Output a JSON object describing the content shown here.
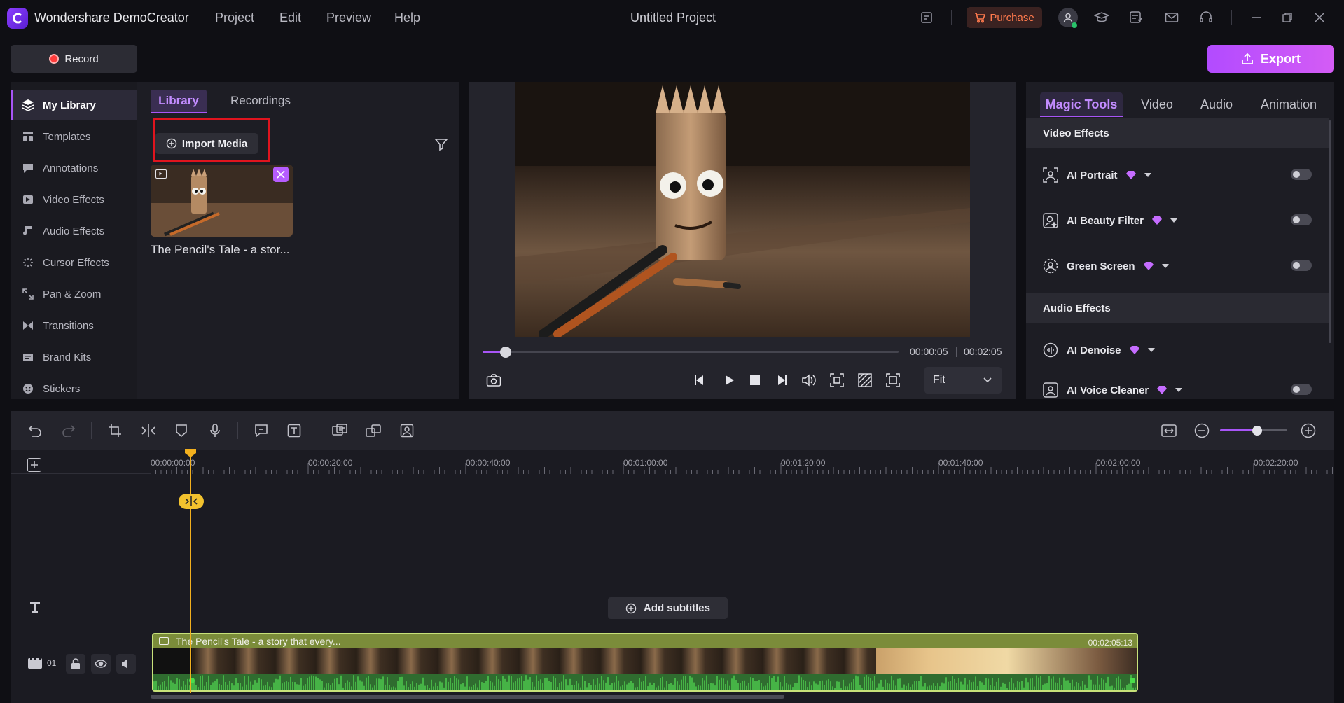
{
  "app": {
    "title": "Wondershare DemoCreator",
    "project_title": "Untitled Project",
    "menu": [
      "Project",
      "Edit",
      "Preview",
      "Help"
    ],
    "purchase_label": "Purchase"
  },
  "actions": {
    "record_label": "Record",
    "export_label": "Export"
  },
  "sidebar": {
    "items": [
      {
        "label": "My Library",
        "icon": "layers-icon",
        "active": true
      },
      {
        "label": "Templates",
        "icon": "templates-icon"
      },
      {
        "label": "Annotations",
        "icon": "annotation-icon"
      },
      {
        "label": "Video Effects",
        "icon": "video-effects-icon"
      },
      {
        "label": "Audio Effects",
        "icon": "audio-effects-icon"
      },
      {
        "label": "Cursor Effects",
        "icon": "cursor-effects-icon"
      },
      {
        "label": "Pan & Zoom",
        "icon": "pan-zoom-icon"
      },
      {
        "label": "Transitions",
        "icon": "transitions-icon"
      },
      {
        "label": "Brand Kits",
        "icon": "brand-kits-icon"
      },
      {
        "label": "Stickers",
        "icon": "stickers-icon"
      }
    ]
  },
  "library": {
    "tabs": [
      "Library",
      "Recordings"
    ],
    "import_label": "Import Media",
    "media": [
      {
        "name": "The Pencil's Tale - a stor..."
      }
    ]
  },
  "preview": {
    "current_time": "00:00:05",
    "total_time": "00:02:05",
    "progress": 0.05,
    "fit_value": "Fit"
  },
  "right_panel": {
    "tabs": [
      "Magic Tools",
      "Video",
      "Audio",
      "Animation"
    ],
    "sections": [
      {
        "title": "Video Effects",
        "items": [
          "AI Portrait",
          "AI Beauty Filter",
          "Green Screen"
        ]
      },
      {
        "title": "Audio Effects",
        "items": [
          "AI Denoise",
          "AI Voice Cleaner"
        ]
      }
    ]
  },
  "timeline": {
    "ruler_labels": [
      "00:00:00:00",
      "00:00:20:00",
      "00:00:40:00",
      "00:01:00:00",
      "00:01:20:00",
      "00:01:40:00",
      "00:02:00:00",
      "00:02:20:00"
    ],
    "add_subtitles_label": "Add subtitles",
    "track_number": "01",
    "clip_title": "The Pencil's Tale - a story that every...",
    "clip_duration": "00:02:05:13",
    "zoom_level": 0.55
  },
  "colors": {
    "accent": "#a855f7",
    "playhead": "#f2b01e",
    "record": "#ff3b3b",
    "highlight": "#e0141e"
  }
}
